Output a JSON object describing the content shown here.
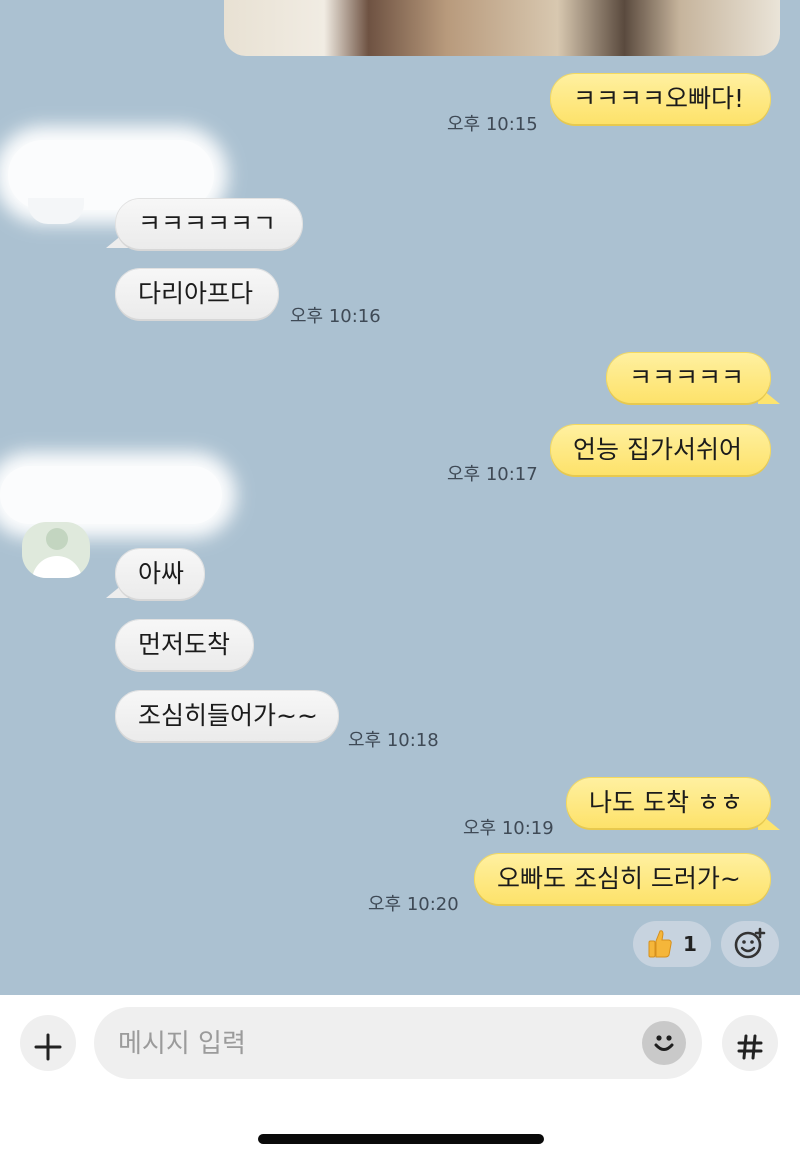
{
  "messages": [
    {
      "text": "ㅋㅋㅋㅋ오빠다!",
      "side": "out",
      "time": "오후 10:15"
    },
    {
      "text": "ㅋㅋㅋㅋㅋㄱ",
      "side": "in"
    },
    {
      "text": "다리아프다",
      "side": "in",
      "time": "오후 10:16"
    },
    {
      "text": "ㅋㅋㅋㅋㅋ",
      "side": "out"
    },
    {
      "text": "언능 집가서쉬어",
      "side": "out",
      "time": "오후 10:17"
    },
    {
      "text": "아싸",
      "side": "in"
    },
    {
      "text": "먼저도착",
      "side": "in"
    },
    {
      "text": "조심히들어가~~",
      "side": "in",
      "time": "오후 10:18"
    },
    {
      "text": "나도 도착 ㅎㅎ",
      "side": "out",
      "time": "오후 10:19"
    },
    {
      "text": "오빠도 조심히 드러가~",
      "side": "out",
      "time": "오후 10:20"
    }
  ],
  "reaction": {
    "icon": "thumbs-up-icon",
    "count": "1"
  },
  "input": {
    "placeholder": "메시지 입력"
  },
  "icons": {
    "add": "plus-icon",
    "emoji": "smiley-icon",
    "hashtag": "hashtag-icon",
    "add_reaction": "add-reaction-icon"
  },
  "colors": {
    "chat_background": "#abc1d1",
    "outgoing_bubble": "#fde26a",
    "incoming_bubble": "#efefef"
  }
}
